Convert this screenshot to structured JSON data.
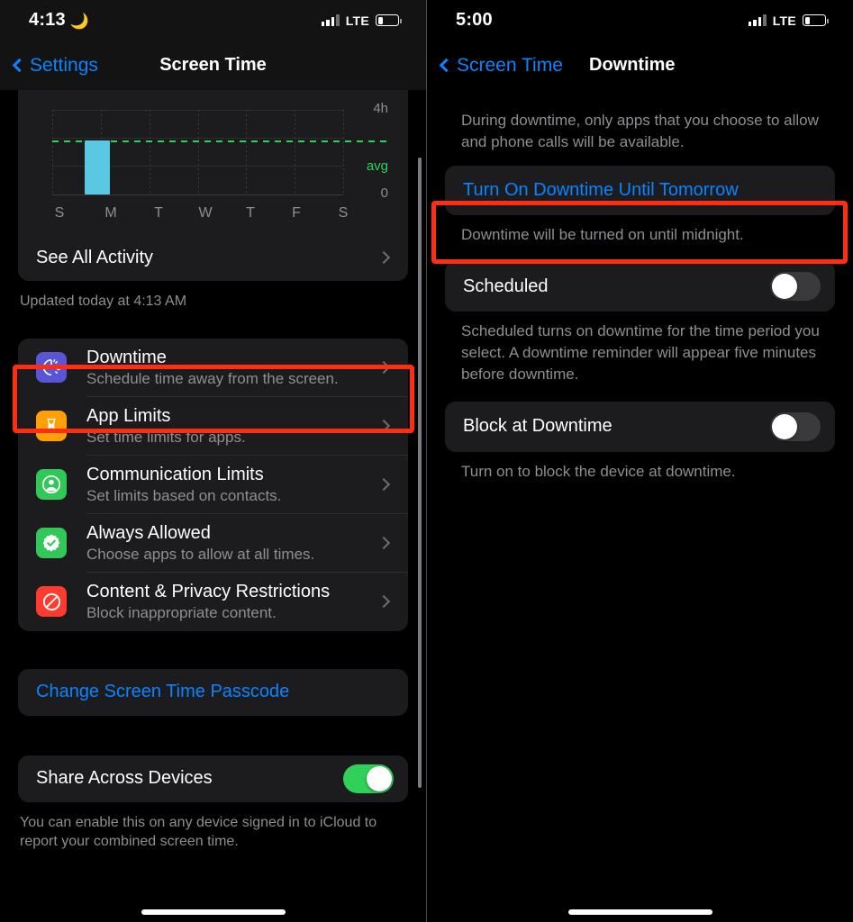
{
  "left": {
    "status": {
      "time": "4:13",
      "moon_icon": "crescent-moon",
      "carrier": "LTE",
      "battery_percent": 28
    },
    "nav": {
      "back_label": "Settings",
      "title": "Screen Time"
    },
    "chart_card": {
      "see_all_label": "See All Activity",
      "updated_label": "Updated today at 4:13 AM"
    },
    "items": [
      {
        "title": "Downtime",
        "subtitle": "Schedule time away from the screen.",
        "icon": "moon-clock-icon",
        "icon_color": "#5856d6",
        "highlighted": true
      },
      {
        "title": "App Limits",
        "subtitle": "Set time limits for apps.",
        "icon": "hourglass-icon",
        "icon_color": "#ff9f0a",
        "highlighted": false
      },
      {
        "title": "Communication Limits",
        "subtitle": "Set limits based on contacts.",
        "icon": "person-circle-icon",
        "icon_color": "#32c759",
        "highlighted": false
      },
      {
        "title": "Always Allowed",
        "subtitle": "Choose apps to allow at all times.",
        "icon": "checkmark-seal-icon",
        "icon_color": "#32c759",
        "highlighted": false
      },
      {
        "title": "Content & Privacy Restrictions",
        "subtitle": "Block inappropriate content.",
        "icon": "no-entry-icon",
        "icon_color": "#ff3b30",
        "highlighted": false
      }
    ],
    "passcode": {
      "label": "Change Screen Time Passcode"
    },
    "share": {
      "label": "Share Across Devices",
      "toggle_state": "on",
      "footnote": "You can enable this on any device signed in to iCloud to report your combined screen time."
    }
  },
  "right": {
    "status": {
      "time": "5:00",
      "carrier": "LTE",
      "battery_percent": 28
    },
    "nav": {
      "back_label": "Screen Time",
      "title": "Downtime"
    },
    "description": "During downtime, only apps that you choose to allow and phone calls will be available.",
    "turn_on_button": {
      "label": "Turn On Downtime Until Tomorrow",
      "highlighted": true
    },
    "turn_on_note": "Downtime will be turned on until midnight.",
    "scheduled": {
      "label": "Scheduled",
      "toggle_state": "off",
      "note": "Scheduled turns on downtime for the time period you select. A downtime reminder will appear five minutes before downtime."
    },
    "block": {
      "label": "Block at Downtime",
      "toggle_state": "off",
      "note": "Turn on to block the device at downtime."
    }
  },
  "colors": {
    "accent_blue": "#0a84ff",
    "highlight_red": "#ff2d11",
    "bar_cyan": "#5ac8e3",
    "avg_green": "#30d158",
    "toggle_on_green": "#30d158"
  },
  "chart_data": {
    "type": "bar",
    "title": "",
    "categories": [
      "S",
      "M",
      "T",
      "W",
      "T",
      "F",
      "S"
    ],
    "values": [
      0,
      2.55,
      0,
      0,
      0,
      0,
      0
    ],
    "xlabel": "",
    "ylabel": "",
    "ylim": [
      0,
      4
    ],
    "ytick_labels": [
      "4h",
      "0"
    ],
    "average_line": {
      "label": "avg",
      "value": 2.55,
      "color": "#30d158",
      "style": "dashed"
    },
    "grid": true,
    "bar_color": "#5ac8e3",
    "units": "hours"
  }
}
